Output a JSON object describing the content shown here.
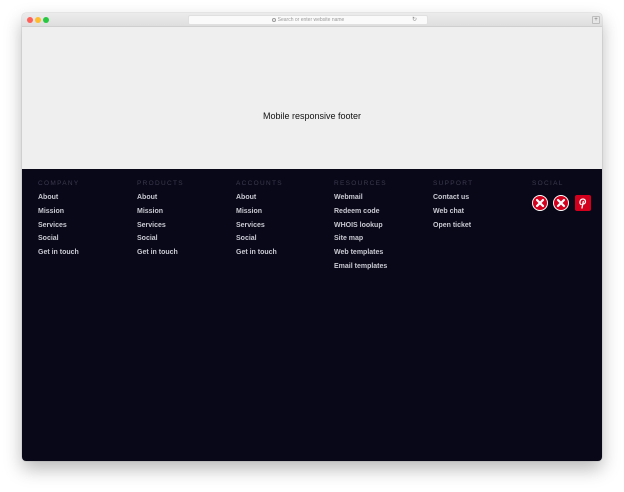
{
  "browser": {
    "address_placeholder": "Search or enter website name"
  },
  "hero": {
    "text": "Mobile responsive footer"
  },
  "footer": {
    "columns": [
      {
        "title": "COMPANY",
        "links": [
          "About",
          "Mission",
          "Services",
          "Social",
          "Get in touch"
        ]
      },
      {
        "title": "PRODUCTS",
        "links": [
          "About",
          "Mission",
          "Services",
          "Social",
          "Get in touch"
        ]
      },
      {
        "title": "ACCOUNTS",
        "links": [
          "About",
          "Mission",
          "Services",
          "Social",
          "Get in touch"
        ]
      },
      {
        "title": "RESOURCES",
        "links": [
          "Webmail",
          "Redeem code",
          "WHOIS lookup",
          "Site map",
          "Web templates",
          "Email templates"
        ]
      },
      {
        "title": "SUPPORT",
        "links": [
          "Contact us",
          "Web chat",
          "Open ticket"
        ]
      },
      {
        "title": "SOCIAL",
        "links": []
      }
    ],
    "social_icons": [
      "broken-image-icon",
      "broken-image-icon",
      "pinterest-icon"
    ]
  },
  "colors": {
    "footer_bg": "#090818",
    "hero_bg": "#efefef",
    "link_color": "#c9c9d2",
    "heading_color": "#3b3a4e",
    "social_red": "#d3001d"
  }
}
